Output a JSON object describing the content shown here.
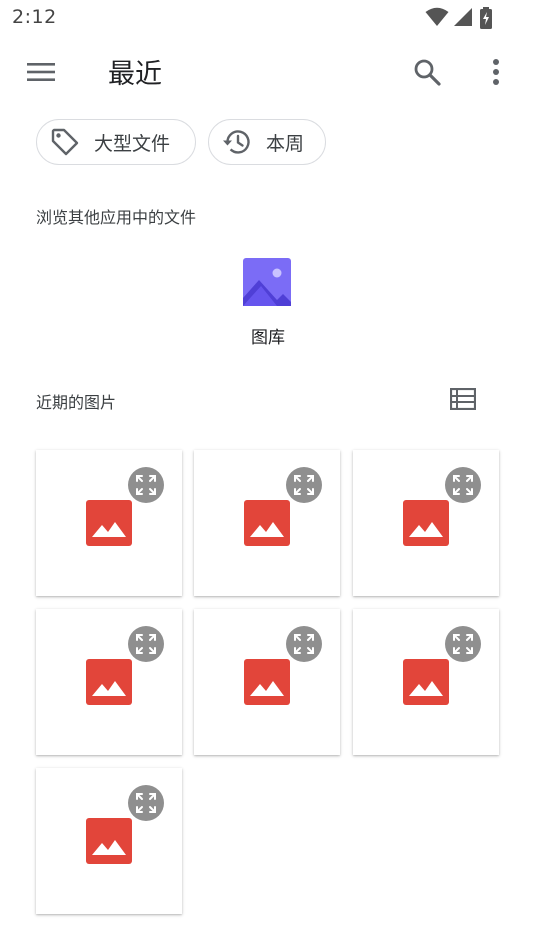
{
  "status_bar": {
    "time": "2:12"
  },
  "app_bar": {
    "title": "最近"
  },
  "chips": [
    {
      "label": "大型文件",
      "icon": "tag-icon"
    },
    {
      "label": "本周",
      "icon": "history-icon"
    }
  ],
  "browse": {
    "heading": "浏览其他应用中的文件",
    "apps": [
      {
        "label": "图库",
        "icon": "gallery-icon"
      }
    ]
  },
  "recent": {
    "heading": "近期的图片",
    "items": [
      {
        "thumbnail_icon": "image-icon"
      },
      {
        "thumbnail_icon": "image-icon"
      },
      {
        "thumbnail_icon": "image-icon"
      },
      {
        "thumbnail_icon": "image-icon"
      },
      {
        "thumbnail_icon": "image-icon"
      },
      {
        "thumbnail_icon": "image-icon"
      },
      {
        "thumbnail_icon": "image-icon"
      }
    ]
  },
  "colors": {
    "image_thumbnail": "#e2453a",
    "gallery_icon": "#7b6cf6",
    "expand_button": "#8f8f8f",
    "chip_border": "#dadce0"
  }
}
